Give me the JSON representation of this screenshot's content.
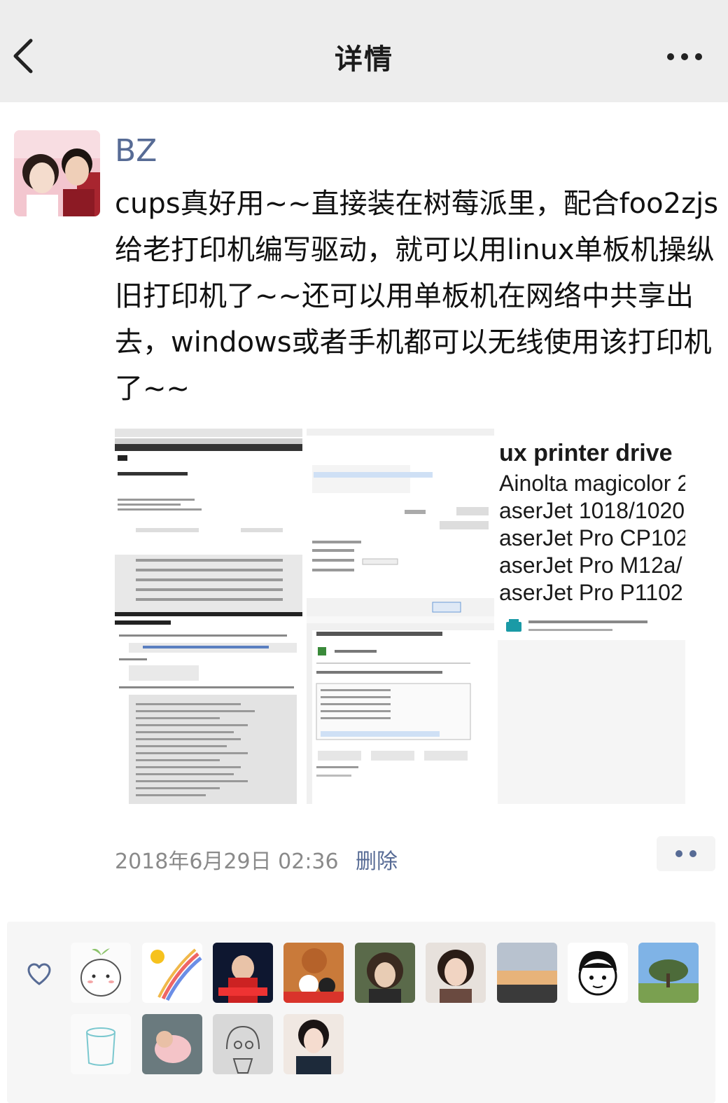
{
  "header": {
    "title": "详情",
    "back_icon": "chevron-left-icon",
    "more_icon": "more-dots-icon"
  },
  "post": {
    "username": "BZ",
    "text": "cups真好用~~直接装在树莓派里，配合foo2zjs给老打印机编写驱动，就可以用linux单板机操纵旧打印机了~~还可以用单板机在网络中共享出去，windows或者手机都可以无线使用该打印机了~~",
    "images": {
      "printer_list": {
        "heading": "ux printer drive",
        "lines": [
          "Ainolta magicolor 2",
          "aserJet 1018/1020",
          "aserJet Pro CP102",
          "aserJet Pro M12a/",
          "aserJet Pro P1102"
        ]
      }
    },
    "timestamp": "2018年6月29日 02:36",
    "delete_label": "删除"
  },
  "likes": {
    "icon": "heart-icon",
    "count": 13
  },
  "colors": {
    "link": "#576b95",
    "header_bg": "#ededed",
    "likes_bg": "#f6f6f6"
  }
}
